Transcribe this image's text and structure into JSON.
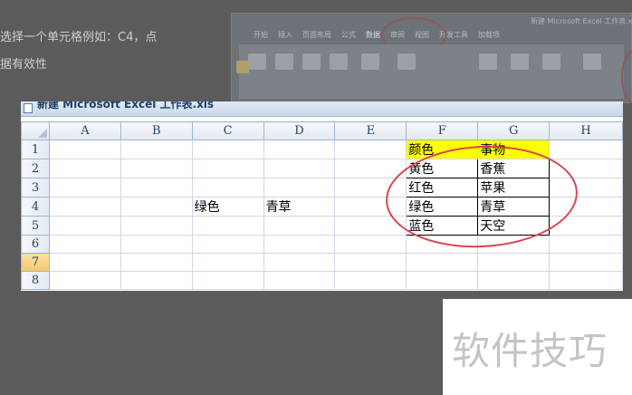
{
  "article": {
    "line1": "选择一个单元格例如：C4，点",
    "line2": "据有效性"
  },
  "ribbon": {
    "title": "新建 Microsoft Excel 工作表.xls",
    "tabs": [
      "开始",
      "插入",
      "页面布局",
      "公式",
      "数据",
      "审阅",
      "视图",
      "开发工具",
      "加载项"
    ]
  },
  "excel": {
    "window_title": "新建 Microsoft Excel 工作表.xls",
    "columns": [
      "A",
      "B",
      "C",
      "D",
      "E",
      "F",
      "G",
      "H"
    ],
    "rows": [
      "1",
      "2",
      "3",
      "4",
      "5",
      "6",
      "7",
      "8"
    ],
    "selected_row": "7",
    "cells": {
      "C4": "绿色",
      "D4": "青草",
      "F1": "颜色",
      "G1": "事物",
      "F2": "黄色",
      "G2": "香蕉",
      "F3": "红色",
      "G3": "苹果",
      "F4": "绿色",
      "G4": "青草",
      "F5": "蓝色",
      "G5": "天空"
    }
  },
  "watermark": {
    "text": "软件技巧"
  },
  "colors": {
    "header_fill": "#ffff00",
    "annotation_circle": "#d9434e",
    "selected_row_header": "#f6c56a"
  }
}
